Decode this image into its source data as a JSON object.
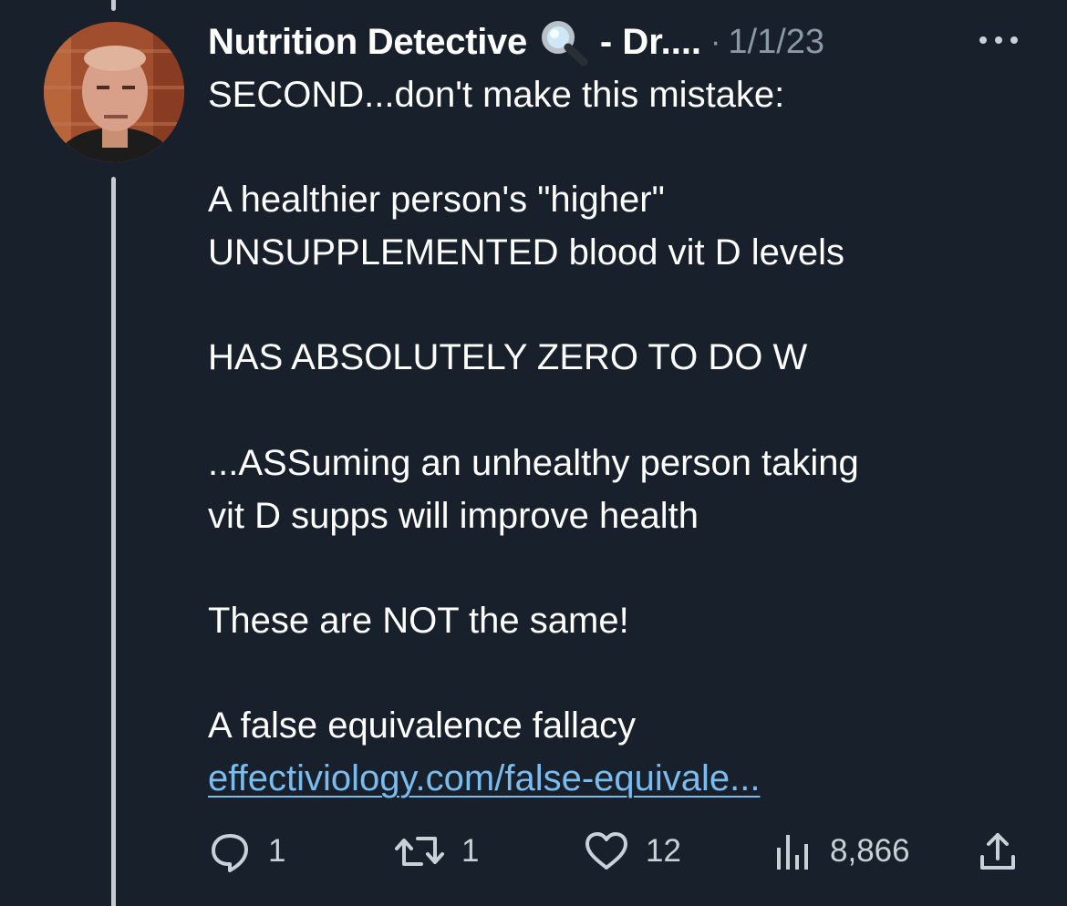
{
  "tweet": {
    "author": {
      "display_name": "Nutrition Detective",
      "badge_icon": "magnifying-glass-icon",
      "name_suffix": "- Dr....",
      "separator": "·",
      "timestamp": "1/1/23"
    },
    "more_icon": "more-horizontal-icon",
    "body_lines": [
      "SECOND...don't make this mistake:",
      "",
      "A healthier person's \"higher\"",
      "UNSUPPLEMENTED blood vit D levels",
      "",
      "HAS ABSOLUTELY ZERO TO DO W",
      "",
      "...ASSuming an unhealthy person taking",
      "vit D supps will improve health",
      "",
      "These are NOT the same!",
      "",
      "A false equivalence fallacy"
    ],
    "link_text": "effectiviology.com/false-equivale...",
    "actions": {
      "reply": {
        "icon": "reply-icon",
        "count": "1"
      },
      "retweet": {
        "icon": "retweet-icon",
        "count": "1"
      },
      "like": {
        "icon": "heart-icon",
        "count": "12"
      },
      "views": {
        "icon": "views-chart-icon",
        "count": "8,866"
      },
      "share": {
        "icon": "share-icon"
      }
    }
  },
  "colors": {
    "background": "#18202b",
    "text_primary": "#ffffff",
    "text_secondary": "#8b98a5",
    "link": "#7bbcef",
    "thread_line": "#c4cbd3"
  }
}
